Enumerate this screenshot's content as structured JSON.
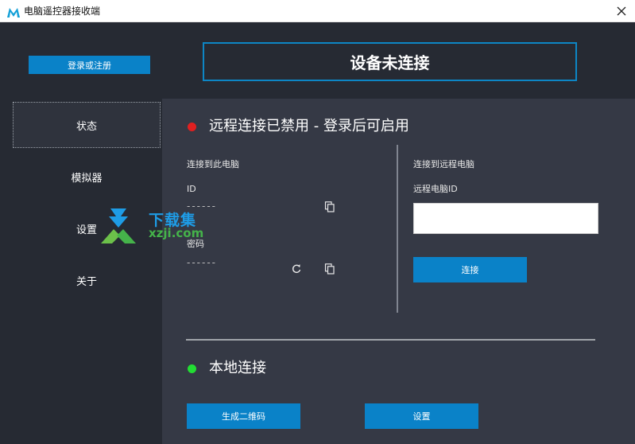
{
  "window": {
    "title": "电脑遥控器接收端"
  },
  "header": {
    "login_label": "登录或注册",
    "status_text": "设备未连接"
  },
  "sidebar": {
    "items": [
      {
        "label": "状态"
      },
      {
        "label": "模拟器"
      },
      {
        "label": "设置"
      },
      {
        "label": "关于"
      }
    ]
  },
  "remote": {
    "heading": "远程连接已禁用 - 登录后可启用",
    "this_pc": {
      "title": "连接到此电脑",
      "id_label": "ID",
      "id_value": "------",
      "password_label": "密码",
      "password_value": "------"
    },
    "remote_pc": {
      "title": "连接到远程电脑",
      "id_label": "远程电脑ID",
      "input_value": "",
      "connect_label": "连接"
    }
  },
  "local": {
    "heading": "本地连接",
    "qr_label": "生成二维码",
    "settings_label": "设置"
  },
  "watermark": {
    "cn": "下载集",
    "en": "xzji.com"
  },
  "colors": {
    "accent": "#0a82c8",
    "disabled_dot": "#e02020",
    "enabled_dot": "#22dd33",
    "panel": "#353945",
    "background": "#262a33"
  },
  "icons": {
    "copy": "copy-icon",
    "refresh": "refresh-icon",
    "close": "close-icon",
    "logo": "app-logo-icon"
  }
}
